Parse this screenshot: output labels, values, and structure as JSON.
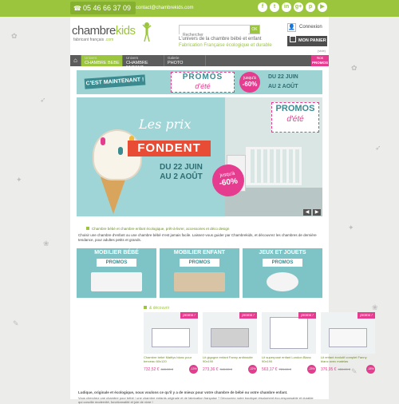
{
  "topbar": {
    "phone": "05 46 66 37 09",
    "email": "contact@chambrekids.com",
    "social": [
      "f",
      "t",
      "in",
      "g+",
      "p",
      "▶"
    ]
  },
  "header": {
    "logo_brand_left": "chambre",
    "logo_brand_right": "kids",
    "logo_domain": ".com",
    "logo_tag": "fabricant français",
    "search_placeholder": "Rechercher",
    "search_button": "OK",
    "tagline1": "L'univers de la chambre bébé et enfant",
    "tagline2": "Fabrication Française écologique et durable",
    "account_label": "Connexion",
    "cart_label": "MON PANIER",
    "cart_sub": "(vide)"
  },
  "nav": {
    "items": [
      {
        "l1": "Univers",
        "l2": "CHAMBRE BEBE",
        "active": true
      },
      {
        "l1": "Univers",
        "l2": "CHAMBRE ENFANT",
        "active": false
      },
      {
        "l1": "Galerie",
        "l2": "PHOTO",
        "active": false
      }
    ],
    "promo_l1": "Nos",
    "promo_l2": "PROMOS"
  },
  "banner": {
    "now": "C'EST MAINTENANT !",
    "promos": "PROMOS",
    "ete": "d'été",
    "jusqua": "jusqu'à",
    "discount": "-60%",
    "dates_l1": "DU 22 JUIN",
    "dates_l2": "AU 2 AOÛT"
  },
  "slider": {
    "title": "Les prix",
    "ribbon": "FONDENT",
    "dates_l1": "DU 22 JUIN",
    "dates_l2": "AU 2 AOÛT",
    "promos": "PROMOS",
    "ete": "d'été",
    "jusqua": "jusqu'à",
    "discount": "-60%",
    "prev": "◀",
    "next": "▶"
  },
  "intro": {
    "heading": "Chambre bébé et chambre enfant écologique, prêt-à-livrer, accessoires et déco design",
    "body": "Choisir une chambre d'enfant ou une chambre bébé n'est jamais facile. Laissez-vous guider par Chambrekids, et découvrez les chambres de dernière tendance, pour adultes petits et grands."
  },
  "categories": [
    {
      "title": "MOBILIER BÉBÉ",
      "sub": "PROMOS",
      "bg": "#7ec4c7"
    },
    {
      "title": "MOBILIER ENFANT",
      "sub": "PROMOS",
      "bg": "#7ec4c7"
    },
    {
      "title": "JEUX ET JOUETS",
      "sub": "PROMOS",
      "bg": "#7ec4c7"
    }
  ],
  "products_section": "& découvrir",
  "products": [
    {
      "badge": "promo !",
      "name": "Chambre bébé Maëlys blanc pour berceau 60x120",
      "price": "732,52 €",
      "old": "849,00 €",
      "pct": "-13%"
    },
    {
      "badge": "promo !",
      "name": "Lit gigogne enfant Fanny anthracite 90x190",
      "price": "273,36 €",
      "old": "349,00 €",
      "pct": "-22%"
    },
    {
      "badge": "promo !",
      "name": "Lit superposé enfant London Blanc 90x190",
      "price": "563,17 €",
      "old": "729,00 €",
      "pct": "-23%"
    },
    {
      "badge": "promo !",
      "name": "Lit enfant évolutif complet Fanny blanc avec matelas",
      "price": "376,95 €",
      "old": "459,00 €",
      "pct": "-18%"
    }
  ],
  "outro": {
    "heading": "Ludique, originale et écologique, nous voulons ce qu'il y a de mieux pour votre chambre de bébé ou votre chambre enfant.",
    "body": "Vous cherchez une chambre pour bébé / une chambre enfants originale et de fabrication française ? Découvrez notre boutique résolument éco-responsable et durable qui concilie modernité, fonctionnalité et joie de vivre !"
  },
  "colors": {
    "brand_green": "#9bc53d",
    "promo_pink": "#e53c8f",
    "teal": "#3a8a8f",
    "nav_grey": "#5c5c5c"
  }
}
